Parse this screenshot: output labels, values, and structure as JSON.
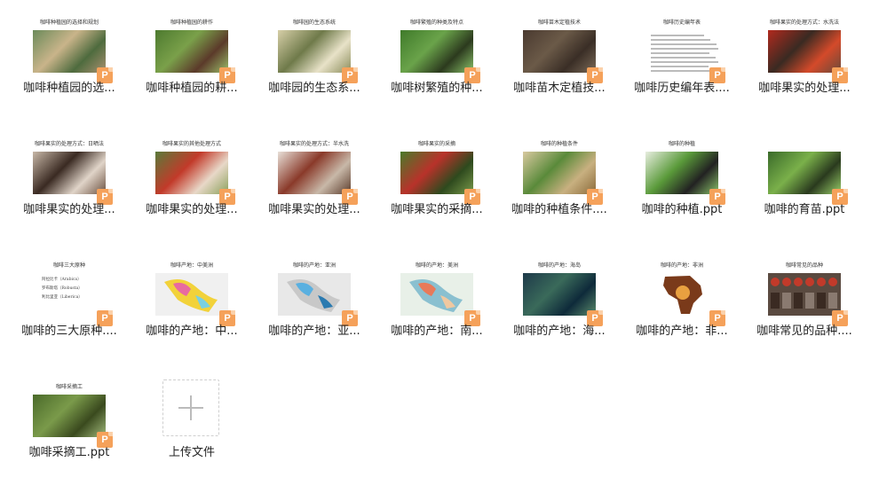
{
  "files": [
    {
      "name": "咖啡种植园的选...",
      "slide_title": "咖啡种植园的选择和规划",
      "kind": "photo",
      "colors": [
        "#6b8a5a",
        "#c9b48a",
        "#4e6b3e",
        "#a89070"
      ]
    },
    {
      "name": "咖啡种植园的耕...",
      "slide_title": "咖啡种植园的耕作",
      "kind": "photo",
      "colors": [
        "#4d7a2f",
        "#7aa04a",
        "#5b3a2a",
        "#9bbf6a"
      ]
    },
    {
      "name": "咖啡园的生态系...",
      "slide_title": "咖啡园的生态系统",
      "kind": "photo",
      "colors": [
        "#d7cfa8",
        "#6f7a4a",
        "#e8e2c8",
        "#8a8c5a"
      ]
    },
    {
      "name": "咖啡树繁殖的种...",
      "slide_title": "咖啡繁殖的种类及特点",
      "kind": "photo",
      "colors": [
        "#3f7a2a",
        "#6aa34a",
        "#2c3a1e",
        "#8ac36a"
      ]
    },
    {
      "name": "咖啡苗木定植技...",
      "slide_title": "咖啡苗木定植技术",
      "kind": "photo",
      "colors": [
        "#4a3a30",
        "#6b5a48",
        "#3a2e26",
        "#7a6a58"
      ]
    },
    {
      "name": "咖啡历史编年表....",
      "slide_title": "咖啡历史编年表",
      "kind": "text",
      "colors": []
    },
    {
      "name": "咖啡果实的处理...",
      "slide_title": "咖啡果实的处理方式：水洗法",
      "kind": "photo",
      "colors": [
        "#b22a1e",
        "#3a2a22",
        "#d44a2a",
        "#6a4a3a"
      ]
    },
    {
      "name": "咖啡果实的处理...",
      "slide_title": "咖啡果实的处理方式：日晒法",
      "kind": "photo",
      "colors": [
        "#c8b8a8",
        "#3a2a22",
        "#e0d4c8",
        "#6a5040"
      ]
    },
    {
      "name": "咖啡果实的处理...",
      "slide_title": "咖啡果实的其他处理方式",
      "kind": "photo",
      "colors": [
        "#5a7a3a",
        "#c23a2a",
        "#e8d8c8",
        "#8aa05a"
      ]
    },
    {
      "name": "咖啡果实的处理...",
      "slide_title": "咖啡果实的处理方式：半水洗",
      "kind": "photo",
      "colors": [
        "#e8e0d8",
        "#8a3a2a",
        "#c8b8a8",
        "#5a3a2a"
      ]
    },
    {
      "name": "咖啡果实的采摘...",
      "slide_title": "咖啡果实的采摘",
      "kind": "photo",
      "colors": [
        "#4a7a2a",
        "#b8322a",
        "#2e4a1e",
        "#7a9a4a"
      ]
    },
    {
      "name": "咖啡的种植条件....",
      "slide_title": "咖啡的种植条件",
      "kind": "photo",
      "colors": [
        "#d9c9a0",
        "#5a8a3a",
        "#c8b080",
        "#8a6a3a"
      ]
    },
    {
      "name": "咖啡的种植.ppt",
      "slide_title": "咖啡的种植",
      "kind": "photo",
      "colors": [
        "#e8eee0",
        "#5a9a3a",
        "#222",
        "#8ac36a"
      ]
    },
    {
      "name": "咖啡的育苗.ppt",
      "slide_title": "",
      "kind": "photo",
      "colors": [
        "#3a6a2a",
        "#7ab04a",
        "#2a3a1e",
        "#9ad06a"
      ]
    },
    {
      "name": "咖啡的三大原种....",
      "slide_title": "咖啡三大原种",
      "kind": "list",
      "lines": [
        "阿拉比卡（Arabica）",
        "罗布斯塔（Robusta）",
        "利比里亚（Liberica）"
      ],
      "colors": []
    },
    {
      "name": "咖啡的产地：中...",
      "slide_title": "咖啡产地：中美洲",
      "kind": "map",
      "colors": [
        "#f0f0f0",
        "#e86aa0",
        "#f2d23a",
        "#7ad0e0"
      ]
    },
    {
      "name": "咖啡的产地：亚...",
      "slide_title": "咖啡的产地：亚洲",
      "kind": "map",
      "colors": [
        "#e8e8e8",
        "#5ab0e0",
        "#c8c8c8",
        "#2a7ab0"
      ]
    },
    {
      "name": "咖啡的产地：南...",
      "slide_title": "咖啡的产地：美洲",
      "kind": "map",
      "colors": [
        "#e8f0e8",
        "#e87a5a",
        "#8ac0d0",
        "#f0c8a0"
      ]
    },
    {
      "name": "咖啡的产地：海...",
      "slide_title": "咖啡的产地：海岛",
      "kind": "photo",
      "colors": [
        "#1e3a4a",
        "#3a6a5a",
        "#0e2a3a",
        "#5a8a6a"
      ]
    },
    {
      "name": "咖啡的产地：非...",
      "slide_title": "咖啡的产地：非洲",
      "kind": "africa",
      "colors": [
        "#7a3a1a",
        "#e8a040",
        "#fff",
        "#3a1a0a"
      ]
    },
    {
      "name": "咖啡常见的品种....",
      "slide_title": "咖啡常见的品种",
      "kind": "beans",
      "colors": [
        "#5a4a40",
        "#c23a2a",
        "#8a7a70",
        "#3a2a22"
      ]
    },
    {
      "name": "咖啡采摘工.ppt",
      "slide_title": "咖啡采摘工",
      "kind": "photo",
      "colors": [
        "#4a6a2a",
        "#7a9a4a",
        "#3a4a1e",
        "#a0b87a"
      ]
    }
  ],
  "upload": {
    "label": "上传文件"
  },
  "badge_letter": "P"
}
